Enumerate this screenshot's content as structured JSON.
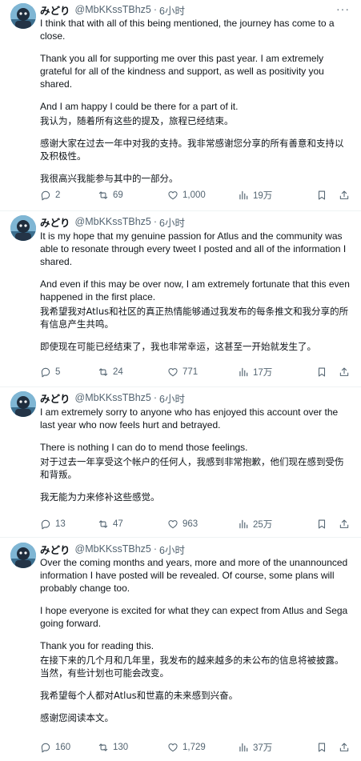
{
  "posts": [
    {
      "author": {
        "name": "みどり",
        "handle": "@MbKKssTBhz5",
        "time": "6小时"
      },
      "en": [
        "I think that with all of this being mentioned, the journey has come to a close.",
        "Thank you all for supporting me over this past year. I am extremely grateful for all of the kindness and support, as well as positivity you shared.",
        "And I am happy I could be there for a part of it."
      ],
      "zh": [
        "我认为，随着所有这些的提及，旅程已经结束。",
        "感谢大家在过去一年中对我的支持。我非常感谢您分享的所有善意和支持以及积极性。",
        "我很高兴我能参与其中的一部分。"
      ],
      "stats": {
        "replies": "2",
        "reposts": "69",
        "likes": "1,000",
        "views": "19万"
      }
    },
    {
      "author": {
        "name": "みどり",
        "handle": "@MbKKssTBhz5",
        "time": "6小时"
      },
      "en": [
        "It is my hope that my genuine passion for Atlus and the community was able to resonate through every tweet I posted and all of the information I shared.",
        "And even if this may be over now, I am extremely fortunate that this even happened in the first place."
      ],
      "zh": [
        "我希望我对Atlus和社区的真正热情能够通过我发布的每条推文和我分享的所有信息产生共鸣。",
        "即使现在可能已经结束了，我也非常幸运，这甚至一开始就发生了。"
      ],
      "stats": {
        "replies": "5",
        "reposts": "24",
        "likes": "771",
        "views": "17万"
      }
    },
    {
      "author": {
        "name": "みどり",
        "handle": "@MbKKssTBhz5",
        "time": "6小时"
      },
      "en": [
        "I am extremely sorry to anyone who has enjoyed this account over the last year who now feels hurt and betrayed.",
        "There is nothing I can do to mend those feelings."
      ],
      "zh": [
        "对于过去一年享受这个帐户的任何人，我感到非常抱歉，他们现在感到受伤和背叛。",
        "我无能为力来修补这些感觉。"
      ],
      "stats": {
        "replies": "13",
        "reposts": "47",
        "likes": "963",
        "views": "25万"
      }
    },
    {
      "author": {
        "name": "みどり",
        "handle": "@MbKKssTBhz5",
        "time": "6小时"
      },
      "en": [
        "Over the coming months and years, more and more of the unannounced information I have posted will be revealed. Of course, some plans will probably change too.",
        "I hope everyone is excited for what they can expect from Atlus and Sega going forward.",
        "Thank you for reading this."
      ],
      "zh": [
        "在接下来的几个月和几年里，我发布的越来越多的未公布的信息将被披露。当然，有些计划也可能会改变。",
        "我希望每个人都对Atlus和世嘉的未来感到兴奋。",
        "感谢您阅读本文。"
      ],
      "stats": {
        "replies": "160",
        "reposts": "130",
        "likes": "1,729",
        "views": "37万"
      }
    }
  ],
  "icons": {
    "reply": "speech-bubble-icon",
    "repost": "repost-arrows-icon",
    "like": "heart-icon",
    "views": "bar-chart-icon",
    "bookmark": "bookmark-icon",
    "share": "share-upload-icon",
    "more": "more-dots-icon"
  },
  "more_glyph": "···",
  "colors": {
    "text": "#0f1419",
    "secondary": "#536471",
    "divider": "#eff3f4",
    "thread_line": "#cfd9de",
    "avatar_bg": "#6aa7c9"
  }
}
